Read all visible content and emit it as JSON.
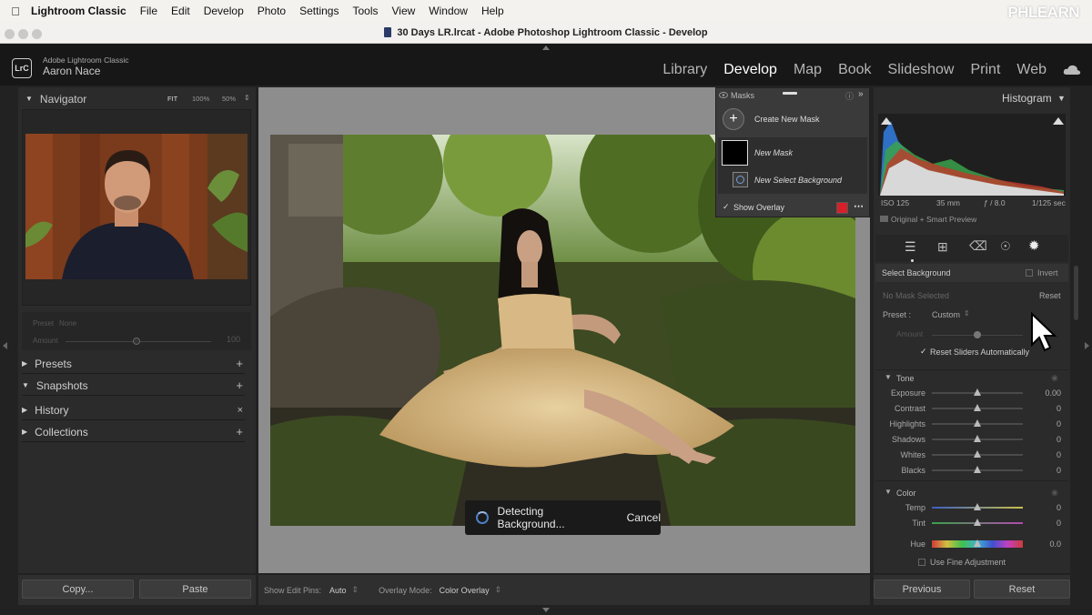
{
  "menubar": {
    "app": "Lightroom Classic",
    "items": [
      "File",
      "Edit",
      "Develop",
      "Photo",
      "Settings",
      "Tools",
      "View",
      "Window",
      "Help"
    ],
    "watermark": "PHLEARN"
  },
  "window": {
    "title": "30 Days LR.lrcat - Adobe Photoshop Lightroom Classic - Develop"
  },
  "identity": {
    "logo": "LrC",
    "subtitle": "Adobe Lightroom Classic",
    "user": "Aaron Nace"
  },
  "modules": [
    "Library",
    "Develop",
    "Map",
    "Book",
    "Slideshow",
    "Print",
    "Web"
  ],
  "active_module": "Develop",
  "left": {
    "navigator": {
      "title": "Navigator",
      "zoom": [
        "FIT",
        "100%",
        "50%"
      ]
    },
    "preset": {
      "label": "Preset",
      "value": "None",
      "amount_label": "Amount",
      "amount_value": "100"
    },
    "sections": [
      "Presets",
      "Snapshots",
      "History",
      "Collections"
    ],
    "copy_label": "Copy...",
    "paste_label": "Paste"
  },
  "toolbar": {
    "pins_label": "Show Edit Pins:",
    "pins_value": "Auto",
    "overlay_label": "Overlay Mode:",
    "overlay_value": "Color Overlay"
  },
  "masks": {
    "title": "Masks",
    "create": "Create New Mask",
    "mask_name": "New Mask",
    "component": "New Select Background",
    "show_overlay": "Show Overlay",
    "overlay_color": "#d8202a"
  },
  "detecting": {
    "text": "Detecting Background...",
    "cancel": "Cancel"
  },
  "right": {
    "histogram_title": "Histogram",
    "iso": "ISO 125",
    "focal": "35 mm",
    "aperture": "ƒ / 8.0",
    "shutter": "1/125 sec",
    "preview": "Original + Smart Preview",
    "mask_type": "Select Background",
    "invert": "Invert",
    "no_mask": "No Mask Selected",
    "reset": "Reset",
    "preset_label": "Preset :",
    "preset_value": "Custom",
    "amount_label": "Amount",
    "reset_sliders": "Reset Sliders Automatically",
    "tone_title": "Tone",
    "tone": [
      {
        "label": "Exposure",
        "value": "0.00"
      },
      {
        "label": "Contrast",
        "value": "0"
      },
      {
        "label": "Highlights",
        "value": "0"
      },
      {
        "label": "Shadows",
        "value": "0"
      },
      {
        "label": "Whites",
        "value": "0"
      },
      {
        "label": "Blacks",
        "value": "0"
      }
    ],
    "color_title": "Color",
    "color": [
      {
        "label": "Temp",
        "value": "0"
      },
      {
        "label": "Tint",
        "value": "0"
      },
      {
        "label": "Hue",
        "value": "0.0"
      }
    ],
    "fine_adjust": "Use Fine Adjustment",
    "previous": "Previous",
    "reset_btn": "Reset"
  }
}
